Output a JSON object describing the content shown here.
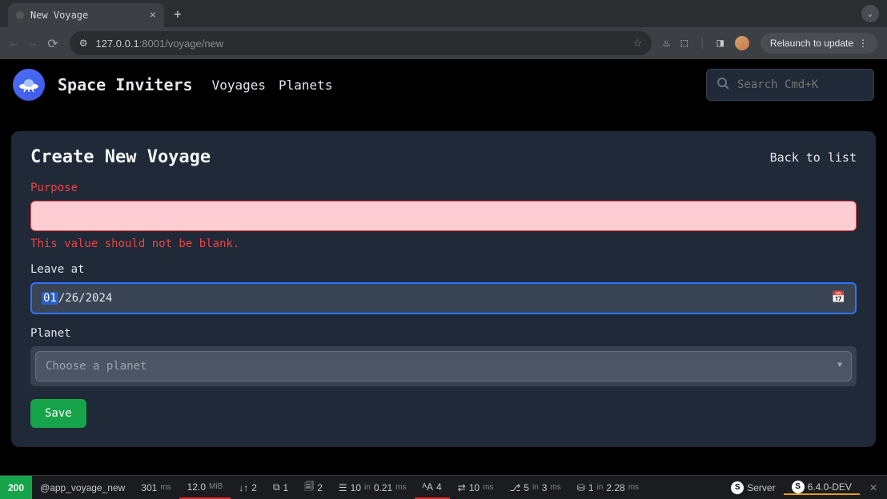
{
  "browser": {
    "tab_title": "New Voyage",
    "url_host": "127.0.0.1",
    "url_port_path": ":8001/voyage/new",
    "relaunch_label": "Relaunch to update"
  },
  "header": {
    "brand": "Space Inviters",
    "nav": {
      "voyages": "Voyages",
      "planets": "Planets"
    },
    "search_placeholder": "Search Cmd+K"
  },
  "card": {
    "title": "Create New Voyage",
    "back_link": "Back to list"
  },
  "form": {
    "purpose": {
      "label": "Purpose",
      "value": "",
      "error": "This value should not be blank."
    },
    "leave_at": {
      "label": "Leave at",
      "month": "01",
      "day": "26",
      "year": "2024"
    },
    "planet": {
      "label": "Planet",
      "placeholder": "Choose a planet"
    },
    "save_label": "Save"
  },
  "debug": {
    "status": "200",
    "route": "@app_voyage_new",
    "time": "301",
    "time_unit": "ms",
    "memory": "12.0",
    "memory_unit": "MiB",
    "ajax": "2",
    "forms": "1",
    "cache": "2",
    "db_count": "10",
    "db_time": "0.21",
    "trans": "4",
    "http": "10",
    "twig_count": "5",
    "twig_time": "3",
    "mail_count": "1",
    "mail_time": "2.28",
    "server": "Server",
    "version": "6.4.0-DEV"
  }
}
